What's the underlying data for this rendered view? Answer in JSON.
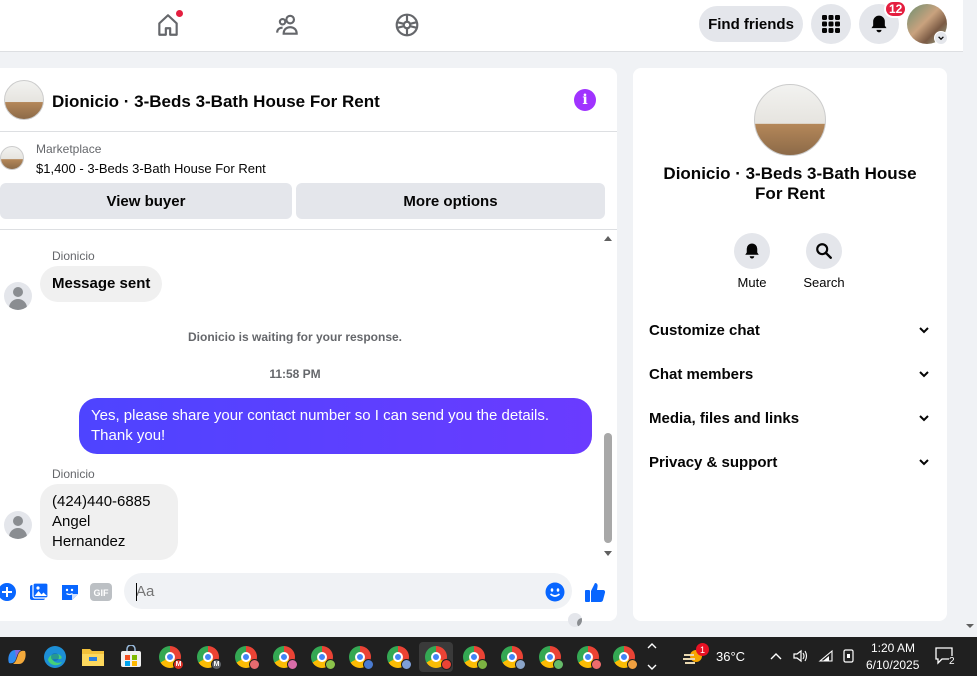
{
  "topnav": {
    "find_friends_label": "Find friends",
    "notification_count": "12"
  },
  "chat": {
    "title": "Dionicio · 3-Beds 3-Bath House For Rent",
    "marketplace": {
      "label": "Marketplace",
      "description": "$1,400 - 3-Beds 3-Bath House For Rent",
      "view_buyer_label": "View buyer",
      "more_options_label": "More options"
    },
    "messages": {
      "m1_sender": "Dionicio",
      "m1_text": "Message sent",
      "system_text": "Dionicio is waiting for your response.",
      "timestamp": "11:58 PM",
      "m2_text": "Yes, please share your contact number so I can send you the details. Thank you!",
      "m3_sender": "Dionicio",
      "m3_line1": "(424)440-6885",
      "m3_line2": "Angel Hernandez"
    },
    "composer": {
      "placeholder": "Aa"
    }
  },
  "info_panel": {
    "title": "Dionicio · 3-Beds 3-Bath House For Rent",
    "mute_label": "Mute",
    "search_label": "Search",
    "sections": [
      "Customize chat",
      "Chat members",
      "Media, files and links",
      "Privacy & support"
    ]
  },
  "taskbar": {
    "weather_temp": "36°C",
    "weather_badge": "1",
    "time": "1:20 AM",
    "date": "6/10/2025",
    "notification_count": "2",
    "apps": [
      "copilot-icon",
      "edge-icon",
      "file-explorer-icon",
      "microsoft-store-icon",
      "chrome-icon"
    ]
  },
  "colors": {
    "accent_purple": "#a033ff",
    "outgoing_bubble": "#5b3ffc",
    "like_blue": "#0866ff",
    "notification_red": "#e41e3f"
  }
}
